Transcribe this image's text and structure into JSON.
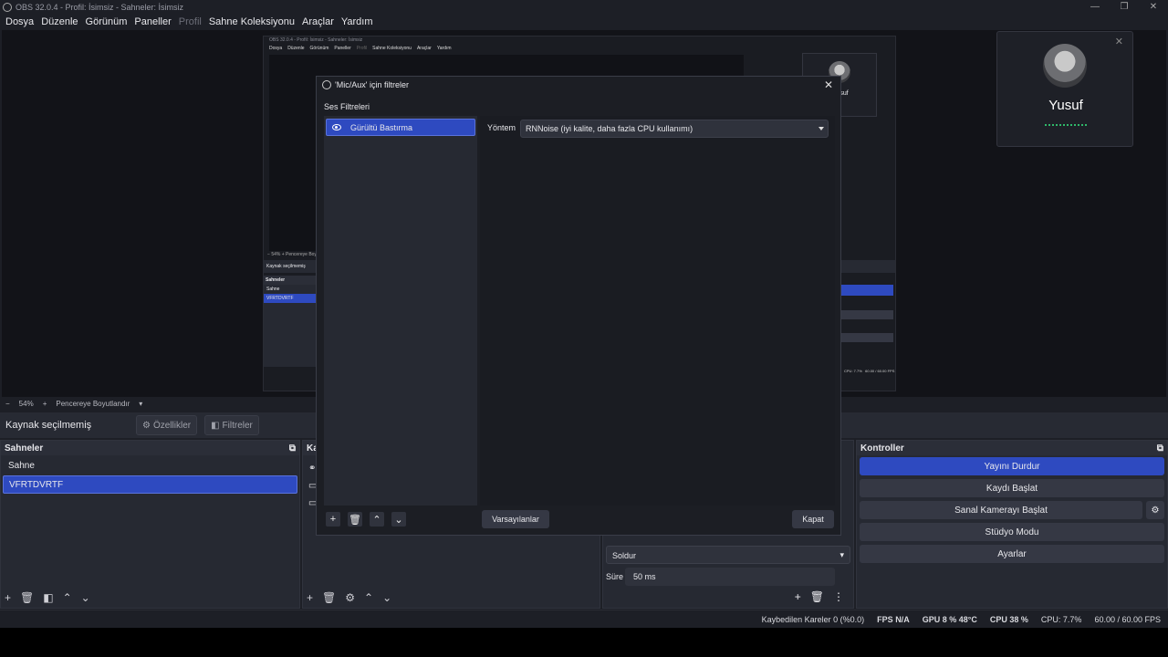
{
  "window": {
    "title": "OBS 32.0.4 - Profil: İsimsiz - Sahneler: İsimsiz",
    "minimize": "—",
    "maximize": "❐",
    "close": "✕"
  },
  "menu": {
    "items": [
      "Dosya",
      "Düzenle",
      "Görünüm",
      "Paneller",
      "Profil",
      "Sahne Koleksiyonu",
      "Araçlar",
      "Yardım"
    ]
  },
  "camera": {
    "name": "Yusuf",
    "close": "✕"
  },
  "preview_bar": {
    "minus": "−",
    "zoom": "54%",
    "plus": "+",
    "mode": "Pencereye Boyutlandır",
    "dropdown": "▾"
  },
  "source_bar": {
    "label": "Kaynak seçilmemiş",
    "properties": "Özellikler",
    "filters": "Filtreler"
  },
  "scenes": {
    "title": "Sahneler",
    "items": [
      "Sahne",
      "VFRTDVRTF"
    ]
  },
  "sources": {
    "title": "Ka"
  },
  "transition": {
    "value": "Soldur",
    "duration_label": "Süre",
    "duration_value": "50 ms"
  },
  "controls": {
    "title": "Kontroller",
    "stop_stream": "Yayını Durdur",
    "start_record": "Kaydı Başlat",
    "virtual_cam": "Sanal Kamerayı Başlat",
    "studio_mode": "Stüdyo Modu",
    "settings": "Ayarlar"
  },
  "status": {
    "dropped": "Kaybedilen Kareler 0 (%0.0)",
    "fps_label": "FPS",
    "fps_value": "N/A",
    "gpu_label": "GPU",
    "gpu_value": "8 %",
    "temp": "48°C",
    "cpu_label": "CPU",
    "cpu_value": "38 %",
    "cpu_obs": "CPU: 7.7%",
    "frames": "60.00 / 60.00 FPS"
  },
  "dialog": {
    "title": "'Mic/Aux' için filtreler",
    "section": "Ses Filtreleri",
    "filter_item": "Gürültü Bastırma",
    "method_label": "Yöntem",
    "method_value": "RNNoise (iyi kalite, daha fazla CPU kullanımı)",
    "defaults": "Varsayılanlar",
    "close_btn": "Kapat",
    "close_icon": "✕"
  },
  "nested": {
    "title": "OBS 32.0.4 - Profil: İsimsiz - Sahneler: İsimsiz",
    "menu": [
      "Dosya",
      "Düzenle",
      "Görünüm",
      "Paneller",
      "Profil",
      "Sahne Koleksiyonu",
      "Araçlar",
      "Yardım"
    ],
    "source_label": "Kaynak seçilmemiş",
    "scenes_title": "Sahneler",
    "scenes": [
      "Sahne",
      "VFRTDVRTF"
    ],
    "cam_name": "Yusuf",
    "zoom": "54%",
    "fit": "Pencereye Boyutlandır",
    "cpu": "CPU: 7.7%",
    "fps": "60.00 / 60.00 FPS"
  },
  "icons": {
    "accent": "#2e4ac0",
    "mic_indicator": "#2fb86a"
  }
}
